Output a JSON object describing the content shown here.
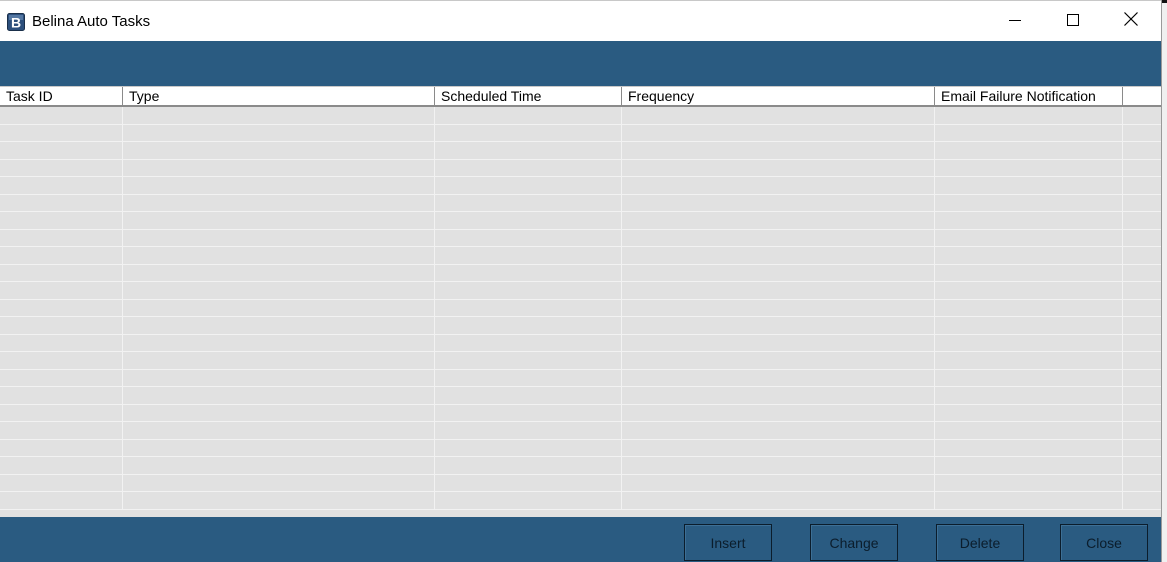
{
  "window": {
    "title": "Belina Auto Tasks",
    "icon": "belina-app-icon",
    "controls": {
      "minimize_icon": "minimize-icon",
      "maximize_icon": "maximize-icon",
      "close_icon": "close-icon"
    }
  },
  "colors": {
    "accent": "#2a5b81",
    "grid_background": "#e1e1e1",
    "header_background": "#ffffff"
  },
  "table": {
    "columns": [
      {
        "key": "task_id",
        "label": "Task ID"
      },
      {
        "key": "type",
        "label": "Type"
      },
      {
        "key": "scheduled_time",
        "label": "Scheduled Time"
      },
      {
        "key": "frequency",
        "label": "Frequency"
      },
      {
        "key": "email_failure_notification",
        "label": "Email Failure Notification"
      },
      {
        "key": "extra",
        "label": ""
      }
    ],
    "rows": []
  },
  "footer": {
    "insert_label": "Insert",
    "change_label": "Change",
    "delete_label": "Delete",
    "close_label": "Close"
  }
}
